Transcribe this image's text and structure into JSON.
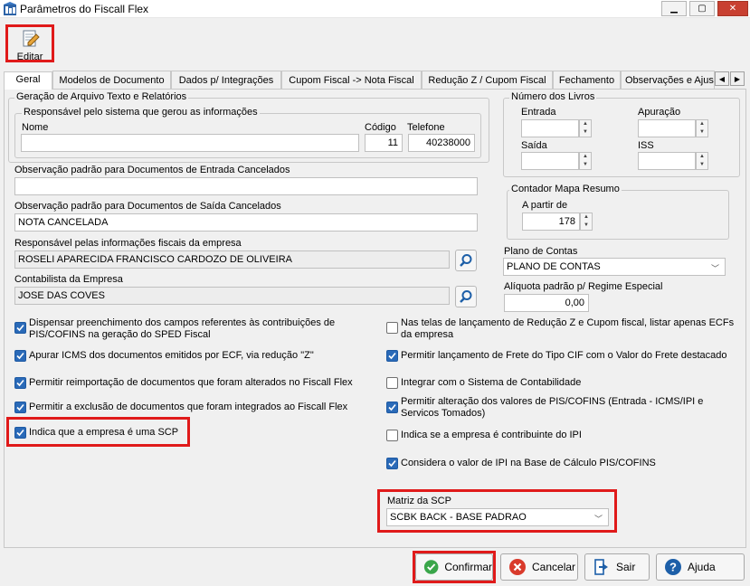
{
  "window": {
    "title": "Parâmetros do Fiscall Flex",
    "min": "▁",
    "max": "▢",
    "close": "✕"
  },
  "toolbar": {
    "editar_label": "Editar"
  },
  "tabs": [
    "Geral",
    "Modelos de Documento",
    "Dados p/ Integrações",
    "Cupom Fiscal -> Nota Fiscal",
    "Redução Z / Cupom Fiscal",
    "Fechamento",
    "Observações e Ajus"
  ],
  "tab_scroll": {
    "left": "◀",
    "right": "▶"
  },
  "geracao": {
    "title": "Geração de Arquivo Texto e Relatórios",
    "responsavel_title": "Responsável pelo sistema que gerou as informações",
    "nome_label": "Nome",
    "nome_value": "",
    "codigo_label": "Código",
    "codigo_value": "11",
    "telefone_label": "Telefone",
    "telefone_value": "40238000"
  },
  "obs_entrada": {
    "label": "Observação padrão para Documentos de Entrada Cancelados",
    "value": ""
  },
  "obs_saida": {
    "label": "Observação padrão para Documentos de Saída Cancelados",
    "value": "NOTA CANCELADA"
  },
  "resp_fiscal": {
    "label": "Responsável pelas informações fiscais da empresa",
    "value": "ROSELI APARECIDA FRANCISCO CARDOZO DE OLIVEIRA"
  },
  "contabilista": {
    "label": "Contabilista da Empresa",
    "value": "JOSE DAS COVES"
  },
  "livros": {
    "title": "Número dos Livros",
    "entrada_label": "Entrada",
    "entrada_value": "",
    "apuracao_label": "Apuração",
    "apuracao_value": "",
    "saida_label": "Saída",
    "saida_value": "",
    "iss_label": "ISS",
    "iss_value": ""
  },
  "contador": {
    "title": "Contador Mapa Resumo",
    "apartir_label": "A partir de",
    "apartir_value": "178"
  },
  "plano": {
    "label": "Plano de Contas",
    "value": "PLANO DE CONTAS"
  },
  "aliquota": {
    "label": "Alíquota padrão p/ Regime Especial",
    "value": "0,00"
  },
  "checks_left": [
    {
      "text": "Dispensar preenchimento dos campos referentes às contribuições de PIS/COFINS na geração do SPED Fiscal",
      "checked": true
    },
    {
      "text": "Apurar ICMS dos documentos emitidos por ECF, via redução \"Z\"",
      "checked": true
    },
    {
      "text": "Permitir reimportação de documentos que foram alterados no Fiscall Flex",
      "checked": true
    },
    {
      "text": "Permitir a exclusão de documentos que foram integrados ao Fiscall Flex",
      "checked": true
    },
    {
      "text": "Indica que a empresa é uma SCP",
      "checked": true
    }
  ],
  "checks_right": [
    {
      "text": "Nas telas de lançamento de Redução Z e Cupom fiscal, listar apenas ECFs da empresa",
      "checked": false
    },
    {
      "text": "Permitir lançamento de Frete do Tipo CIF com o Valor do Frete destacado",
      "checked": true
    },
    {
      "text": "Integrar com o Sistema de Contabilidade",
      "checked": false
    },
    {
      "text": "Permitir alteração dos valores de PIS/COFINS (Entrada - ICMS/IPI e Servicos Tomados)",
      "checked": true
    },
    {
      "text": "Indica se a empresa é contribuinte do IPI",
      "checked": false
    },
    {
      "text": "Considera o valor de IPI na Base de Cálculo PIS/COFINS",
      "checked": true
    }
  ],
  "matriz": {
    "label": "Matriz da SCP",
    "value": "SCBK BACK - BASE PADRAO"
  },
  "buttons": {
    "confirmar": "Confirmar",
    "cancelar": "Cancelar",
    "sair": "Sair",
    "ajuda": "Ajuda"
  },
  "colors": {
    "highlight": "#e01a1a",
    "check": "#2a6ab8"
  }
}
